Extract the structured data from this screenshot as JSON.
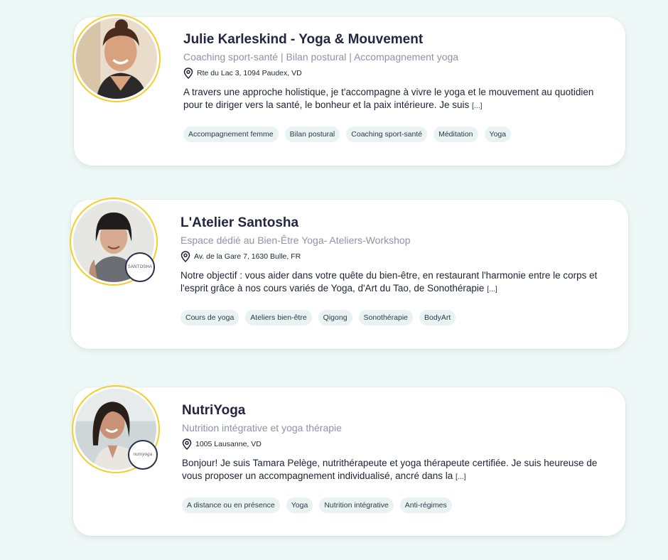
{
  "listings": [
    {
      "name": "Julie Karleskind - Yoga & Mouvement",
      "subtitle": "Coaching sport-santé | Bilan postural | Accompagnement yoga",
      "address": "Rte du Lac 3, 1094 Paudex, VD",
      "description": "A travers une approche holistique, je t'accompagne à vivre le yoga et le mouvement au quotidien pour te diriger vers la santé, le bonheur et la paix intérieure. Je suis",
      "more": "[...]",
      "tags": [
        "Accompagnement femme",
        "Bilan postural",
        "Coaching sport-santé",
        "Méditation",
        "Yoga"
      ]
    },
    {
      "name": "L'Atelier Santosha",
      "subtitle": "Espace dédié au Bien-Être Yoga- Ateliers-Workshop",
      "address": "Av. de la Gare 7, 1630 Bulle, FR",
      "description": "Notre objectif : vous aider dans votre quête du bien-être, en restaurant l'harmonie entre le corps et l'esprit grâce à nos cours variés de Yoga, d'Art du Tao, de Sonothérapie",
      "more": "[...]",
      "tags": [
        "Cours de yoga",
        "Ateliers bien-être",
        "Qigong",
        "Sonothérapie",
        "BodyArt"
      ],
      "logo_text": "SANTOSHA"
    },
    {
      "name": "NutriYoga",
      "subtitle": "Nutrition intégrative et yoga thérapie",
      "address": "1005 Lausanne, VD",
      "description": "Bonjour! Je suis Tamara Pelège, nutrithérapeute et yoga thérapeute certifiée. Je suis heureuse de vous proposer un accompagnement individualisé, ancré dans la",
      "more": "[...]",
      "tags": [
        "A distance ou en présence",
        "Yoga",
        "Nutrition intégrative",
        "Anti-régimes"
      ],
      "logo_text": "nutriyoga"
    }
  ],
  "colors": {
    "background": "#eef8f6",
    "card": "#ffffff",
    "avatar_ring": "#f2cf2e",
    "tag_bg": "#e8f3f2",
    "subtitle": "#8e93a6"
  },
  "icons": {
    "address": "map-pin-icon"
  }
}
